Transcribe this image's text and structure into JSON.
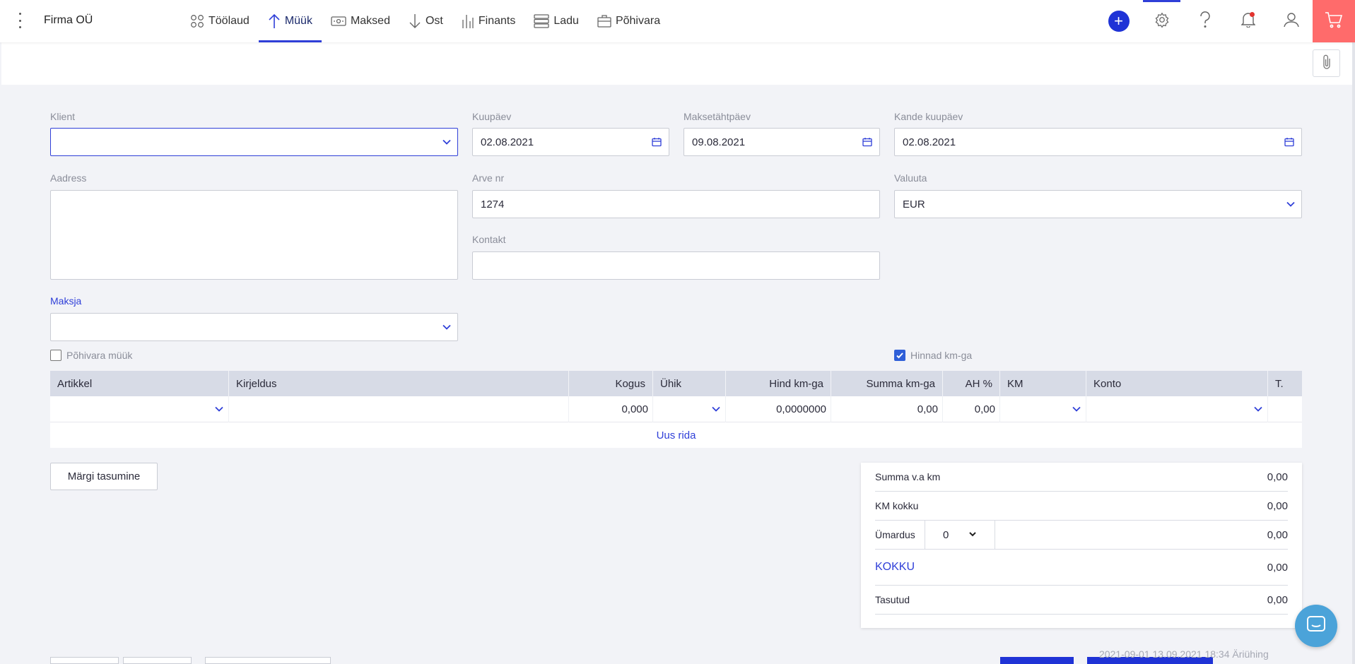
{
  "app": {
    "company": "Firma OÜ"
  },
  "nav": {
    "items": [
      {
        "label": "Töölaud",
        "icon": "dashboard-icon"
      },
      {
        "label": "Müük",
        "icon": "arrow-up-icon"
      },
      {
        "label": "Maksed",
        "icon": "money-icon"
      },
      {
        "label": "Ost",
        "icon": "arrow-down-icon"
      },
      {
        "label": "Finants",
        "icon": "bar-chart-icon"
      },
      {
        "label": "Ladu",
        "icon": "warehouse-icon"
      },
      {
        "label": "Põhivara",
        "icon": "briefcase-icon"
      }
    ],
    "active": "Müük"
  },
  "colors": {
    "accent": "#2f3fd8",
    "cart": "#ff6b6b",
    "chat": "#4ba3d9",
    "notification": "#e3342f"
  },
  "form": {
    "klient": {
      "label": "Klient",
      "value": ""
    },
    "kuupaev": {
      "label": "Kuupäev",
      "value": "02.08.2021"
    },
    "maksetahtpaev": {
      "label": "Maksetähtpäev",
      "value": "09.08.2021"
    },
    "kande_kuupaev": {
      "label": "Kande kuupäev",
      "value": "02.08.2021"
    },
    "aadress": {
      "label": "Aadress",
      "value": ""
    },
    "arve_nr": {
      "label": "Arve nr",
      "value": "1274"
    },
    "valuuta": {
      "label": "Valuuta",
      "value": "EUR"
    },
    "kontakt": {
      "label": "Kontakt",
      "value": ""
    },
    "maksja": {
      "label": "Maksja",
      "value": ""
    },
    "pohivara_muuk": {
      "label": "Põhivara müük",
      "checked": false
    },
    "hinnad_kmga": {
      "label": "Hinnad km-ga",
      "checked": true
    }
  },
  "table": {
    "columns": [
      "Artikkel",
      "Kirjeldus",
      "Kogus",
      "Ühik",
      "Hind km-ga",
      "Summa km-ga",
      "AH %",
      "KM",
      "Konto",
      "T."
    ],
    "rows": [
      {
        "artikkel": "",
        "kirjeldus": "",
        "kogus": "0,000",
        "uhik": "",
        "hind": "0,0000000",
        "summa": "0,00",
        "ah": "0,00",
        "km": "",
        "konto": "",
        "t": ""
      }
    ],
    "add_row": "Uus rida"
  },
  "buttons": {
    "margi_tasumine": "Märgi tasumine"
  },
  "totals": {
    "summa_va_km": {
      "label": "Summa v.a km",
      "value": "0,00"
    },
    "km_kokku": {
      "label": "KM kokku",
      "value": "0,00"
    },
    "umardus": {
      "label": "Ümardus",
      "select": "0",
      "value": "0,00"
    },
    "kokku": {
      "label": "KOKKU",
      "value": "0,00"
    },
    "tasutud": {
      "label": "Tasutud",
      "value": "0,00"
    }
  },
  "footer": {
    "text": "2021-09-01 13.09.2021 18:34 Äriühing"
  }
}
